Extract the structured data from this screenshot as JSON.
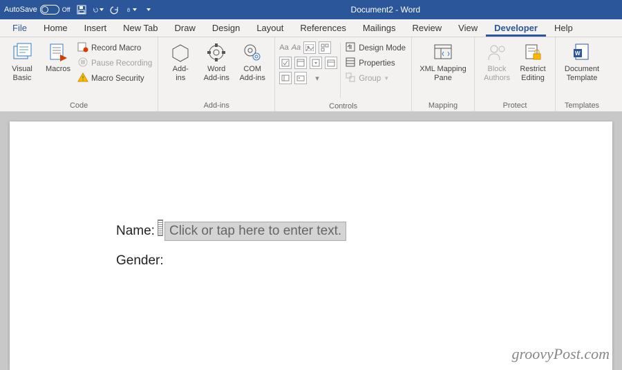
{
  "title_bar": {
    "autosave_label": "AutoSave",
    "autosave_state": "Off",
    "document_title": "Document2  -  Word"
  },
  "tabs": {
    "file": "File",
    "home": "Home",
    "insert": "Insert",
    "newtab": "New Tab",
    "draw": "Draw",
    "design": "Design",
    "layout": "Layout",
    "references": "References",
    "mailings": "Mailings",
    "review": "Review",
    "view": "View",
    "developer": "Developer",
    "help": "Help"
  },
  "ribbon": {
    "code": {
      "visual_basic": "Visual\nBasic",
      "macros": "Macros",
      "record_macro": "Record Macro",
      "pause_recording": "Pause Recording",
      "macro_security": "Macro Security",
      "label": "Code"
    },
    "addins": {
      "addins": "Add-\nins",
      "word_addins": "Word\nAdd-ins",
      "com_addins": "COM\nAdd-ins",
      "label": "Add-ins"
    },
    "controls": {
      "design_mode": "Design Mode",
      "properties": "Properties",
      "group": "Group",
      "label": "Controls"
    },
    "mapping": {
      "xml_mapping": "XML Mapping\nPane",
      "label": "Mapping"
    },
    "protect": {
      "block_authors": "Block\nAuthors",
      "restrict_editing": "Restrict\nEditing",
      "label": "Protect"
    },
    "templates": {
      "doc_template": "Document\nTemplate",
      "label": "Templates"
    }
  },
  "document": {
    "line1_label": "Name:",
    "line1_placeholder": "Click or tap here to enter text.",
    "line2_label": "Gender:"
  },
  "watermark": "groovyPost.com"
}
